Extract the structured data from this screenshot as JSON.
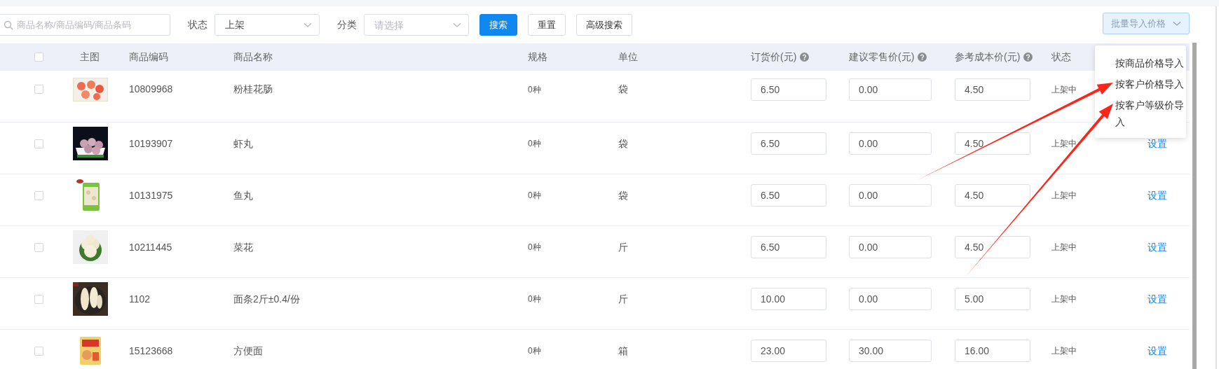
{
  "search": {
    "placeholder": "商品名称/商品编码/商品条码"
  },
  "filters": [
    {
      "label": "状态",
      "value": "上架"
    },
    {
      "label": "分类",
      "placeholder": "请选择"
    }
  ],
  "buttons": [
    {
      "label": "搜索",
      "kind": "primary"
    },
    {
      "label": "重置",
      "kind": "default"
    },
    {
      "label": "高级搜索",
      "kind": "default"
    }
  ],
  "batch_button": {
    "label": "批量导入价格",
    "expanded": true
  },
  "batch_menu": [
    {
      "label": "按商品价格导入",
      "arrow": false
    },
    {
      "label": "按客户价格导入",
      "arrow": true
    },
    {
      "label": "按客户等级价导入",
      "arrow": true
    }
  ],
  "table": {
    "select_all": {
      "checked": false
    },
    "columns": [
      {
        "label": "主图",
        "help": false
      },
      {
        "label": "商品编码",
        "help": false
      },
      {
        "label": "商品名称",
        "help": false
      },
      {
        "label": "规格",
        "help": false
      },
      {
        "label": "单位",
        "help": false
      },
      {
        "label": "订货价(元)",
        "help": true
      },
      {
        "label": "建议零售价(元)",
        "help": true
      },
      {
        "label": "参考成本价(元)",
        "help": true
      },
      {
        "label": "状态",
        "help": false
      }
    ],
    "rows": [
      {
        "checked": false,
        "code": "10809968",
        "name": "粉桂花肠",
        "spec": "0种",
        "unit": "袋",
        "order_price": "6.50",
        "retail_price": "0.00",
        "cost_price": "4.50",
        "status": "上架中"
      },
      {
        "checked": false,
        "code": "10193907",
        "name": "虾丸",
        "spec": "0种",
        "unit": "袋",
        "order_price": "6.50",
        "retail_price": "0.00",
        "cost_price": "4.50",
        "status": "上架中",
        "action": "设置"
      },
      {
        "checked": false,
        "code": "10131975",
        "name": "鱼丸",
        "spec": "0种",
        "unit": "袋",
        "order_price": "6.50",
        "retail_price": "0.00",
        "cost_price": "4.50",
        "status": "上架中",
        "action": "设置"
      },
      {
        "checked": false,
        "code": "10211445",
        "name": "菜花",
        "spec": "0种",
        "unit": "斤",
        "order_price": "6.50",
        "retail_price": "0.00",
        "cost_price": "4.50",
        "status": "上架中",
        "action": "设置"
      },
      {
        "checked": false,
        "code": "1102",
        "name": "面条2斤±0.4/份",
        "spec": "0种",
        "unit": "斤",
        "order_price": "10.00",
        "retail_price": "0.00",
        "cost_price": "5.00",
        "status": "上架中",
        "action": "设置"
      },
      {
        "checked": false,
        "code": "15123668",
        "name": "方便面",
        "spec": "0种",
        "unit": "箱",
        "order_price": "23.00",
        "retail_price": "30.00",
        "cost_price": "16.00",
        "status": "上架中",
        "action": "设置"
      }
    ]
  }
}
